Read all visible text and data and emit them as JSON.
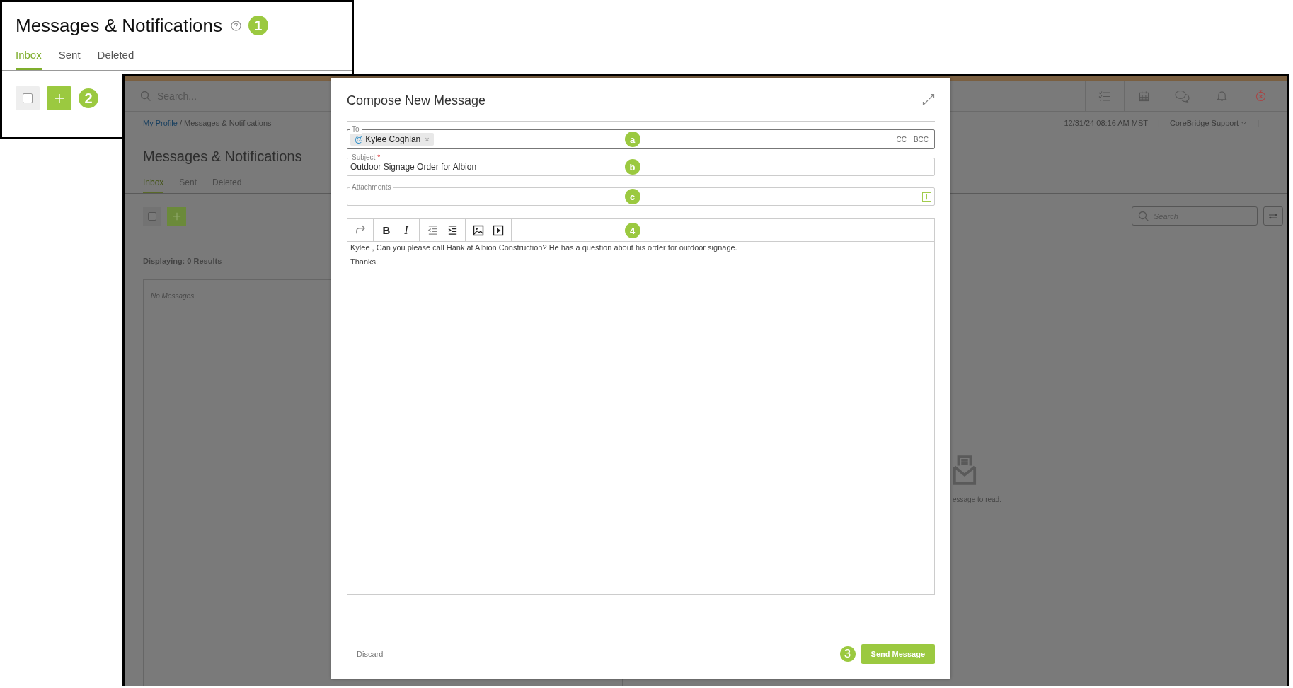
{
  "inset": {
    "title": "Messages & Notifications",
    "title_callout": "1",
    "tabs": [
      {
        "label": "Inbox",
        "selected": true
      },
      {
        "label": "Sent",
        "selected": false
      },
      {
        "label": "Deleted",
        "selected": false
      }
    ],
    "select_all": {
      "checked": false
    },
    "toolbar_callout": "2"
  },
  "app": {
    "search_placeholder": "Search...",
    "breadcrumb": {
      "link": "My Profile",
      "separator": "/",
      "current": "Messages & Notifications"
    },
    "datetime": "12/31/24 08:16 AM MST",
    "divider": "|",
    "user": "CoreBridge Support",
    "title": "Messages & Notifications",
    "tabs": [
      {
        "label": "Inbox",
        "selected": true
      },
      {
        "label": "Sent",
        "selected": false
      },
      {
        "label": "Deleted",
        "selected": false
      }
    ],
    "select_all": {
      "checked": false
    },
    "list_search_placeholder": "Search",
    "results": "Displaying: 0 Results",
    "empty_list": "No Messages",
    "reading_hint": "essage to read."
  },
  "modal": {
    "title": "Compose New Message",
    "to": {
      "label": "To",
      "recipients": [
        {
          "mention": "@",
          "name": "Kylee Coghlan",
          "remove": "×"
        }
      ],
      "cc": "CC",
      "bcc": "BCC",
      "callout": "a"
    },
    "subject": {
      "label": "Subject",
      "required_mark": "*",
      "value": "Outdoor Signage Order for Albion",
      "callout": "b"
    },
    "attachments": {
      "label": "Attachments",
      "callout": "c"
    },
    "editor": {
      "callout": "4",
      "toolbar_groups": [
        {
          "tools": [
            {
              "kind": "redo"
            }
          ]
        },
        {
          "tools": [
            {
              "kind": "bold",
              "label": "B"
            },
            {
              "kind": "italic",
              "label": "I"
            }
          ]
        },
        {
          "tools": [
            {
              "kind": "outdent"
            },
            {
              "kind": "indent"
            }
          ]
        },
        {
          "tools": [
            {
              "kind": "image"
            },
            {
              "kind": "video"
            }
          ]
        }
      ],
      "paragraphs": [
        "Kylee  , Can you please call Hank at Albion Construction? He has a question about his order for outdoor signage.",
        "Thanks,"
      ]
    },
    "discard": "Discard",
    "send": "Send Message",
    "send_callout": "3"
  }
}
